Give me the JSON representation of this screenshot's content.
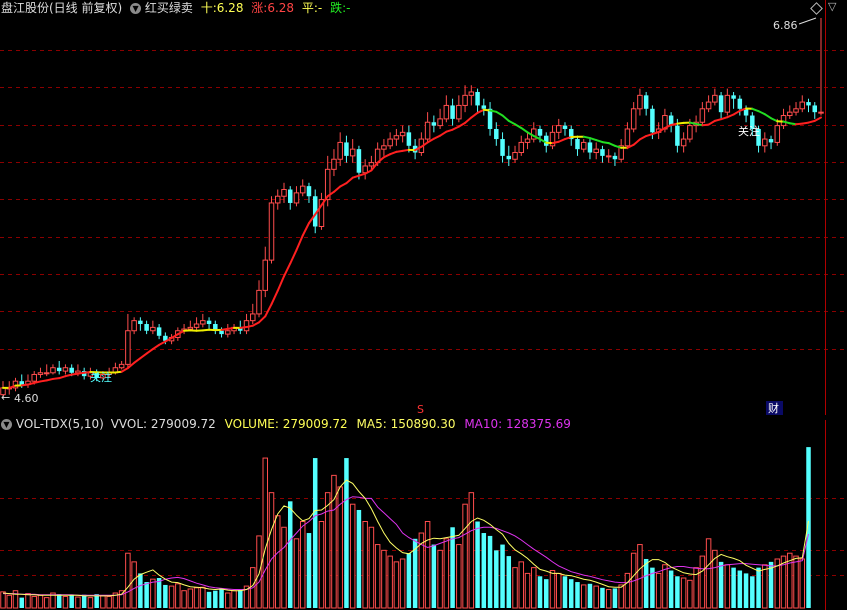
{
  "header": {
    "stock_title": "盘江股份(日线 前复权)",
    "indicator_name": "红买绿卖",
    "cross_label": "十:",
    "cross_value": "6.28",
    "up_label": "涨:",
    "up_value": "6.28",
    "flat_label": "平:",
    "flat_value": "-",
    "down_label": "跌:",
    "down_value": "-",
    "collapse_icon": "chevron-down-icon",
    "settings_icon": "diamond-icon"
  },
  "price_panel": {
    "high_label": "6.86",
    "low_label": "4.60",
    "marker_s": "S",
    "marker_cai": "财",
    "focus_label_1": "关注",
    "focus_label_2": "关注"
  },
  "volume_header": {
    "name": "VOL-TDX(5,10)",
    "vvol_label": "VVOL:",
    "vvol_value": "279009.72",
    "volume_label": "VOLUME:",
    "volume_value": "279009.72",
    "ma5_label": "MA5:",
    "ma5_value": "150890.30",
    "ma10_label": "MA10:",
    "ma10_value": "128375.69"
  },
  "colors": {
    "up": "#ff4d4d",
    "down": "#54ffff",
    "ma_red": "#ff2020",
    "ma_green": "#22dd22",
    "ma_yellow": "#eeee00",
    "ma5": "#ffff66",
    "ma10": "#dd33ee",
    "grid": "#8b0000"
  },
  "chart_data": [
    {
      "type": "candlestick",
      "title": "盘江股份(日线 前复权)",
      "ylim": [
        4.6,
        6.86
      ],
      "series": [
        {
          "name": "OHLC",
          "open": [
            4.62,
            4.66,
            4.66,
            4.7,
            4.68,
            4.7,
            4.74,
            4.75,
            4.75,
            4.78,
            4.76,
            4.78,
            4.75,
            4.76,
            4.73,
            4.75,
            4.72,
            4.74,
            4.75,
            4.78,
            4.8,
            5.0,
            5.06,
            5.04,
            5.0,
            5.02,
            4.97,
            4.94,
            4.96,
            5.0,
            5.01,
            5.02,
            5.04,
            5.06,
            5.04,
            5.0,
            4.98,
            5.0,
            5.02,
            5.0,
            5.06,
            5.1,
            5.24,
            5.42,
            5.76,
            5.8,
            5.84,
            5.76,
            5.82,
            5.86,
            5.8,
            5.62,
            5.78,
            5.96,
            6.02,
            6.12,
            6.04,
            6.08,
            5.94,
            5.98,
            6.0,
            6.08,
            6.1,
            6.14,
            6.16,
            6.18,
            6.1,
            6.06,
            6.14,
            6.24,
            6.22,
            6.26,
            6.34,
            6.26,
            6.34,
            6.4,
            6.42,
            6.34,
            6.32,
            6.2,
            6.14,
            6.04,
            6.02,
            6.06,
            6.12,
            6.14,
            6.2,
            6.16,
            6.1,
            6.18,
            6.22,
            6.2,
            6.14,
            6.08,
            6.12,
            6.06,
            6.08,
            6.04,
            6.04,
            6.02,
            6.1,
            6.2,
            6.32,
            6.4,
            6.32,
            6.18,
            6.2,
            6.28,
            6.22,
            6.1,
            6.14,
            6.22,
            6.24,
            6.32,
            6.36,
            6.4,
            6.3,
            6.4,
            6.38,
            6.32,
            6.28,
            6.2,
            6.1,
            6.14,
            6.12,
            6.22,
            6.28,
            6.3,
            6.32,
            6.36,
            6.34,
            6.3
          ],
          "close": [
            4.66,
            4.66,
            4.7,
            4.68,
            4.7,
            4.74,
            4.75,
            4.75,
            4.78,
            4.76,
            4.78,
            4.75,
            4.76,
            4.73,
            4.75,
            4.72,
            4.74,
            4.75,
            4.78,
            4.8,
            5.0,
            5.06,
            5.04,
            5.0,
            5.02,
            4.97,
            4.94,
            4.96,
            5.0,
            5.01,
            5.02,
            5.04,
            5.06,
            5.04,
            5.0,
            4.98,
            5.0,
            5.02,
            5.0,
            5.06,
            5.1,
            5.24,
            5.42,
            5.76,
            5.8,
            5.84,
            5.76,
            5.82,
            5.86,
            5.8,
            5.62,
            5.78,
            5.96,
            6.02,
            6.12,
            6.04,
            6.08,
            5.94,
            5.98,
            6.0,
            6.08,
            6.1,
            6.14,
            6.16,
            6.18,
            6.1,
            6.06,
            6.14,
            6.24,
            6.22,
            6.26,
            6.34,
            6.26,
            6.34,
            6.4,
            6.42,
            6.34,
            6.32,
            6.2,
            6.14,
            6.04,
            6.02,
            6.06,
            6.12,
            6.14,
            6.2,
            6.16,
            6.1,
            6.18,
            6.22,
            6.2,
            6.14,
            6.08,
            6.12,
            6.06,
            6.08,
            6.04,
            6.04,
            6.02,
            6.1,
            6.2,
            6.32,
            6.4,
            6.32,
            6.18,
            6.2,
            6.28,
            6.22,
            6.1,
            6.14,
            6.22,
            6.24,
            6.32,
            6.36,
            6.4,
            6.3,
            6.4,
            6.38,
            6.32,
            6.28,
            6.2,
            6.1,
            6.14,
            6.12,
            6.22,
            6.28,
            6.3,
            6.32,
            6.36,
            6.34,
            6.3,
            6.3
          ],
          "high": [
            4.7,
            4.7,
            4.72,
            4.74,
            4.74,
            4.76,
            4.78,
            4.8,
            4.8,
            4.82,
            4.8,
            4.8,
            4.8,
            4.78,
            4.78,
            4.77,
            4.76,
            4.78,
            4.81,
            4.82,
            5.1,
            5.08,
            5.08,
            5.06,
            5.06,
            5.04,
            4.99,
            4.98,
            5.02,
            5.04,
            5.06,
            5.08,
            5.1,
            5.08,
            5.06,
            5.02,
            5.04,
            5.04,
            5.06,
            5.1,
            5.16,
            5.3,
            5.5,
            5.8,
            5.84,
            5.88,
            5.86,
            5.86,
            5.9,
            5.88,
            5.84,
            5.82,
            6.04,
            6.08,
            6.18,
            6.16,
            6.14,
            6.1,
            6.02,
            6.04,
            6.12,
            6.14,
            6.18,
            6.2,
            6.22,
            6.22,
            6.14,
            6.18,
            6.3,
            6.28,
            6.32,
            6.4,
            6.38,
            6.4,
            6.46,
            6.46,
            6.44,
            6.38,
            6.36,
            6.24,
            6.18,
            6.1,
            6.1,
            6.16,
            6.18,
            6.24,
            6.22,
            6.18,
            6.22,
            6.26,
            6.24,
            6.22,
            6.16,
            6.14,
            6.14,
            6.12,
            6.1,
            6.08,
            6.06,
            6.14,
            6.24,
            6.36,
            6.44,
            6.42,
            6.34,
            6.24,
            6.32,
            6.3,
            6.26,
            6.18,
            6.26,
            6.28,
            6.36,
            6.4,
            6.44,
            6.42,
            6.44,
            6.42,
            6.4,
            6.34,
            6.3,
            6.22,
            6.18,
            6.16,
            6.26,
            6.32,
            6.34,
            6.36,
            6.4,
            6.38,
            6.36,
            6.86
          ],
          "low": [
            4.6,
            4.62,
            4.64,
            4.66,
            4.66,
            4.68,
            4.72,
            4.73,
            4.74,
            4.74,
            4.74,
            4.73,
            4.73,
            4.71,
            4.71,
            4.7,
            4.71,
            4.72,
            4.74,
            4.77,
            4.78,
            4.98,
            5.0,
            4.98,
            4.98,
            4.95,
            4.92,
            4.92,
            4.94,
            4.98,
            5.0,
            5.0,
            5.02,
            5.0,
            4.98,
            4.96,
            4.96,
            4.98,
            4.98,
            4.98,
            5.04,
            5.08,
            5.2,
            5.4,
            5.72,
            5.76,
            5.72,
            5.74,
            5.8,
            5.76,
            5.58,
            5.6,
            5.74,
            5.92,
            5.98,
            6.0,
            6.0,
            5.9,
            5.9,
            5.96,
            5.98,
            6.04,
            6.08,
            6.1,
            6.12,
            6.06,
            6.02,
            6.04,
            6.12,
            6.18,
            6.2,
            6.24,
            6.22,
            6.24,
            6.3,
            6.34,
            6.3,
            6.28,
            6.16,
            6.1,
            6.0,
            5.98,
            6.0,
            6.04,
            6.08,
            6.12,
            6.12,
            6.06,
            6.08,
            6.14,
            6.16,
            6.1,
            6.04,
            6.06,
            6.02,
            6.02,
            6.0,
            6.0,
            5.98,
            6.0,
            6.08,
            6.18,
            6.28,
            6.28,
            6.14,
            6.14,
            6.18,
            6.18,
            6.06,
            6.06,
            6.12,
            6.18,
            6.22,
            6.3,
            6.34,
            6.26,
            6.28,
            6.32,
            6.28,
            6.24,
            6.16,
            6.06,
            6.06,
            6.08,
            6.1,
            6.2,
            6.26,
            6.28,
            6.3,
            6.3,
            6.26,
            6.28
          ]
        }
      ]
    },
    {
      "type": "bar",
      "title": "VOL-TDX(5,10)",
      "ylim": [
        0,
        300000
      ],
      "series": [
        {
          "name": "VOLUME",
          "values": [
            28000,
            22000,
            30000,
            18000,
            25000,
            20000,
            22000,
            18000,
            26000,
            24000,
            20000,
            22000,
            19000,
            23000,
            18000,
            24000,
            21000,
            20000,
            26000,
            30000,
            95000,
            80000,
            60000,
            45000,
            50000,
            52000,
            40000,
            38000,
            42000,
            30000,
            33000,
            35000,
            36000,
            28000,
            30000,
            34000,
            26000,
            30000,
            32000,
            38000,
            70000,
            125000,
            260000,
            200000,
            160000,
            140000,
            185000,
            120000,
            150000,
            130000,
            260000,
            150000,
            200000,
            230000,
            210000,
            260000,
            180000,
            170000,
            150000,
            140000,
            110000,
            100000,
            90000,
            80000,
            85000,
            95000,
            120000,
            130000,
            150000,
            110000,
            100000,
            120000,
            140000,
            110000,
            180000,
            200000,
            150000,
            130000,
            125000,
            100000,
            110000,
            90000,
            70000,
            80000,
            60000,
            70000,
            55000,
            50000,
            65000,
            60000,
            55000,
            50000,
            45000,
            40000,
            42000,
            38000,
            35000,
            32000,
            34000,
            40000,
            60000,
            95000,
            110000,
            85000,
            70000,
            60000,
            75000,
            65000,
            55000,
            52000,
            48000,
            70000,
            90000,
            120000,
            100000,
            80000,
            75000,
            70000,
            65000,
            60000,
            55000,
            70000,
            75000,
            80000,
            85000,
            90000,
            95000,
            90000,
            85000,
            279000
          ]
        },
        {
          "name": "MA5",
          "values": [
            26000,
            25000,
            24000,
            24000,
            23000,
            23000,
            22000,
            22000,
            22000,
            22000,
            22000,
            22000,
            22000,
            21000,
            21000,
            21000,
            21000,
            21000,
            22000,
            24000,
            36000,
            50000,
            58000,
            62000,
            66000,
            57000,
            50000,
            45000,
            44000,
            40000,
            37000,
            36000,
            35000,
            33000,
            32000,
            33000,
            31000,
            30000,
            30000,
            32000,
            39000,
            59000,
            103000,
            136000,
            163000,
            177000,
            173000,
            161000,
            151000,
            155000,
            169000,
            170000,
            178000,
            188000,
            210000,
            222000,
            216000,
            202000,
            190000,
            172000,
            150000,
            130000,
            114000,
            104000,
            96000,
            94000,
            102000,
            112000,
            118000,
            121000,
            120000,
            122000,
            124000,
            126000,
            138000,
            150000,
            156000,
            152000,
            145000,
            136000,
            128000,
            112000,
            101000,
            94000,
            86000,
            76000,
            67000,
            64000,
            60000,
            60000,
            57000,
            56000,
            53000,
            50000,
            48000,
            45000,
            41000,
            37000,
            36000,
            36000,
            44000,
            56000,
            68000,
            77000,
            84000,
            84000,
            79000,
            71000,
            66000,
            61000,
            59000,
            58000,
            64000,
            75000,
            86000,
            93000,
            89000,
            86000,
            82000,
            74000,
            69000,
            64000,
            67000,
            69000,
            73000,
            78000,
            82000,
            86000,
            87000,
            150890
          ]
        },
        {
          "name": "MA10",
          "values": [
            25000,
            25000,
            25000,
            24000,
            24000,
            24000,
            23000,
            23000,
            23000,
            23000,
            23000,
            23000,
            22000,
            22000,
            22000,
            22000,
            22000,
            22000,
            22000,
            23000,
            28000,
            34000,
            39000,
            42000,
            45000,
            46000,
            50000,
            52000,
            53000,
            51000,
            47000,
            43000,
            40000,
            37000,
            35000,
            34000,
            33000,
            32000,
            32000,
            32000,
            35000,
            45000,
            66000,
            85000,
            96000,
            105000,
            118000,
            130000,
            142000,
            150000,
            160000,
            163000,
            168000,
            170000,
            180000,
            188000,
            193000,
            192000,
            190000,
            190000,
            175000,
            165000,
            155000,
            145000,
            130000,
            122000,
            116000,
            110000,
            105000,
            108000,
            112000,
            116000,
            120000,
            122000,
            128000,
            134000,
            138000,
            140000,
            140000,
            138000,
            134000,
            130000,
            125000,
            118000,
            110000,
            102000,
            95000,
            88000,
            80000,
            73000,
            68000,
            63000,
            60000,
            57000,
            55000,
            52000,
            49000,
            47000,
            45000,
            44000,
            44000,
            47000,
            51000,
            56000,
            60000,
            63000,
            67000,
            70000,
            72000,
            72000,
            70000,
            69000,
            68000,
            68000,
            70000,
            73000,
            75000,
            76000,
            77000,
            77000,
            76000,
            75000,
            74000,
            73000,
            73000,
            75000,
            78000,
            80000,
            82000,
            128376
          ]
        }
      ]
    }
  ]
}
